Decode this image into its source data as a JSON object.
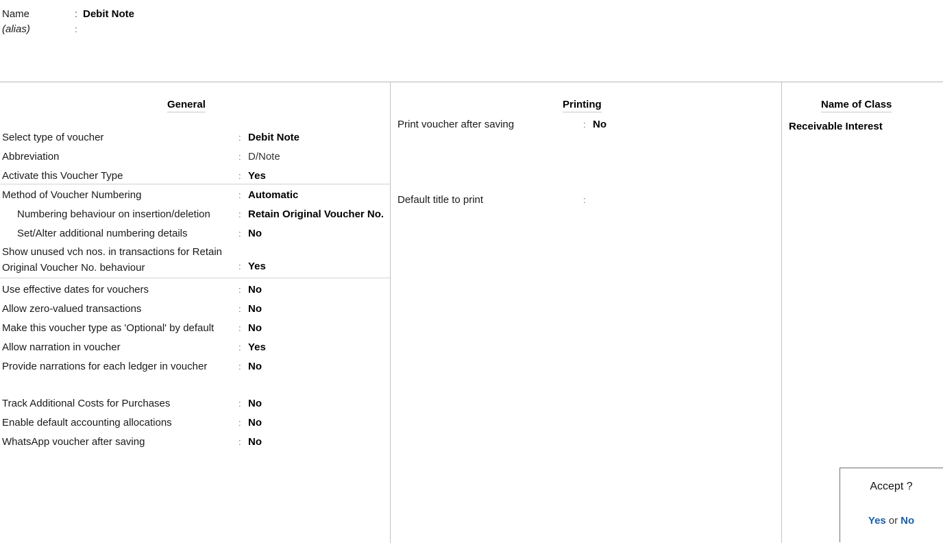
{
  "header": {
    "name_label": "Name",
    "name_colon": ":",
    "name_value": "Debit Note",
    "alias_label": "(alias)",
    "alias_colon": ":",
    "alias_value": ""
  },
  "general": {
    "title": "General",
    "rows": [
      {
        "label": "Select type of voucher",
        "colon": ":",
        "value": "Debit Note",
        "bold": true,
        "indent": false
      },
      {
        "label": "Abbreviation",
        "colon": ":",
        "value": "D/Note",
        "bold": false,
        "indent": false
      },
      {
        "label": "Activate this Voucher Type",
        "colon": ":",
        "value": "Yes",
        "bold": true,
        "indent": false
      },
      {
        "label": "Method of Voucher Numbering",
        "colon": ":",
        "value": "Automatic",
        "bold": true,
        "indent": false
      },
      {
        "label": "Numbering behaviour on insertion/deletion",
        "colon": ":",
        "value": "Retain Original Voucher No.",
        "bold": true,
        "indent": true
      },
      {
        "label": "Set/Alter additional numbering details",
        "colon": ":",
        "value": "No",
        "bold": true,
        "indent": true
      },
      {
        "label": "Show unused vch nos. in transactions for Retain Original Voucher No. behaviour",
        "colon": ":",
        "value": "Yes",
        "bold": true,
        "indent": false
      },
      {
        "label": "Use effective dates for vouchers",
        "colon": ":",
        "value": "No",
        "bold": true,
        "indent": false
      },
      {
        "label": "Allow zero-valued transactions",
        "colon": ":",
        "value": "No",
        "bold": true,
        "indent": false
      },
      {
        "label": "Make this voucher type as 'Optional' by default",
        "colon": ":",
        "value": "No",
        "bold": true,
        "indent": false
      },
      {
        "label": "Allow narration in voucher",
        "colon": ":",
        "value": "Yes",
        "bold": true,
        "indent": false
      },
      {
        "label": "Provide narrations for each ledger in voucher",
        "colon": ":",
        "value": "No",
        "bold": true,
        "indent": false
      },
      {
        "label": "Track Additional Costs for Purchases",
        "colon": ":",
        "value": "No",
        "bold": true,
        "indent": false
      },
      {
        "label": "Enable default accounting allocations",
        "colon": ":",
        "value": "No",
        "bold": true,
        "indent": false
      },
      {
        "label": "WhatsApp voucher after saving",
        "colon": ":",
        "value": "No",
        "bold": true,
        "indent": false
      }
    ]
  },
  "printing": {
    "title": "Printing",
    "rows": [
      {
        "label": "Print voucher after saving",
        "colon": ":",
        "value": "No"
      },
      {
        "label": "Default title to print",
        "colon": ":",
        "value": ""
      }
    ]
  },
  "name_of_class": {
    "title": "Name of Class",
    "items": [
      "Receivable Interest"
    ]
  },
  "accept_dialog": {
    "title": "Accept ?",
    "yes_label": "Yes",
    "separator": "or",
    "no_label": "No",
    "accent_color": "#1b5faa"
  }
}
